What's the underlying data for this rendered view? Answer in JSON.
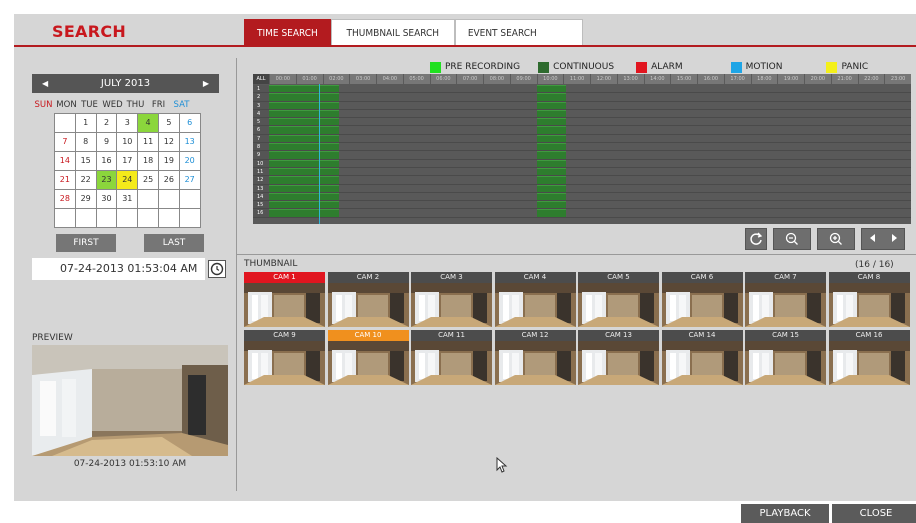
{
  "header": {
    "title": "SEARCH"
  },
  "tabs": [
    {
      "label": "TIME SEARCH"
    },
    {
      "label": "THUMBNAIL SEARCH"
    },
    {
      "label": "EVENT SEARCH"
    }
  ],
  "calendar": {
    "month_label": "JULY 2013",
    "weekdays": [
      "SUN",
      "MON",
      "TUE",
      "WED",
      "THU",
      "FRI",
      "SAT"
    ],
    "weeks": [
      [
        "",
        "1",
        "2",
        "3",
        "4",
        "5",
        "6"
      ],
      [
        "7",
        "8",
        "9",
        "10",
        "11",
        "12",
        "13"
      ],
      [
        "14",
        "15",
        "16",
        "17",
        "18",
        "19",
        "20"
      ],
      [
        "21",
        "22",
        "23",
        "24",
        "25",
        "26",
        "27"
      ],
      [
        "28",
        "29",
        "30",
        "31",
        "",
        "",
        ""
      ],
      [
        "",
        "",
        "",
        "",
        "",
        "",
        ""
      ]
    ],
    "recorded_days": [
      "4",
      "23"
    ],
    "selected_day": "24",
    "first_label": "FIRST",
    "last_label": "LAST"
  },
  "datetime": "07-24-2013  01:53:04 AM",
  "preview": {
    "label": "PREVIEW",
    "timestamp": "07-24-2013  01:53:10 AM"
  },
  "legend": [
    {
      "label": "PRE RECORDING",
      "color": "#1fe01f"
    },
    {
      "label": "CONTINUOUS",
      "color": "#2e6b2e"
    },
    {
      "label": "ALARM",
      "color": "#e1151f"
    },
    {
      "label": "MOTION",
      "color": "#1ea5e6"
    },
    {
      "label": "PANIC",
      "color": "#f4f01a"
    }
  ],
  "timeline": {
    "all_label": "ALL",
    "hours": [
      "00:00",
      "01:00",
      "02:00",
      "03:00",
      "04:00",
      "05:00",
      "06:00",
      "07:00",
      "08:00",
      "09:00",
      "10:00",
      "11:00",
      "12:00",
      "13:00",
      "14:00",
      "15:00",
      "16:00",
      "17:00",
      "18:00",
      "19:00",
      "20:00",
      "21:00",
      "22:00",
      "23:00"
    ],
    "channels": [
      "1",
      "2",
      "3",
      "4",
      "5",
      "6",
      "7",
      "8",
      "9",
      "10",
      "11",
      "12",
      "13",
      "14",
      "15",
      "16"
    ],
    "continuous_ranges": [
      [
        0.0,
        2.6
      ],
      [
        10.0,
        11.1
      ]
    ],
    "cursor_hour": 1.88
  },
  "thumbnail": {
    "label": "THUMBNAIL",
    "count": "(16 / 16)",
    "cams": [
      "CAM 1",
      "CAM 2",
      "CAM 3",
      "CAM 4",
      "CAM 5",
      "CAM 6",
      "CAM 7",
      "CAM 8",
      "CAM 9",
      "CAM 10",
      "CAM 11",
      "CAM 12",
      "CAM 13",
      "CAM 14",
      "CAM 15",
      "CAM 16"
    ],
    "highlighted_red": "CAM 1",
    "highlighted_orange": "CAM 10"
  },
  "footer": {
    "playback": "PLAYBACK",
    "close": "CLOSE"
  },
  "icons": [
    "prev-month-icon",
    "next-month-icon",
    "clock-icon",
    "refresh-icon",
    "zoom-out-icon",
    "zoom-in-icon",
    "prev-icon",
    "next-icon",
    "mouse-pointer-icon"
  ]
}
